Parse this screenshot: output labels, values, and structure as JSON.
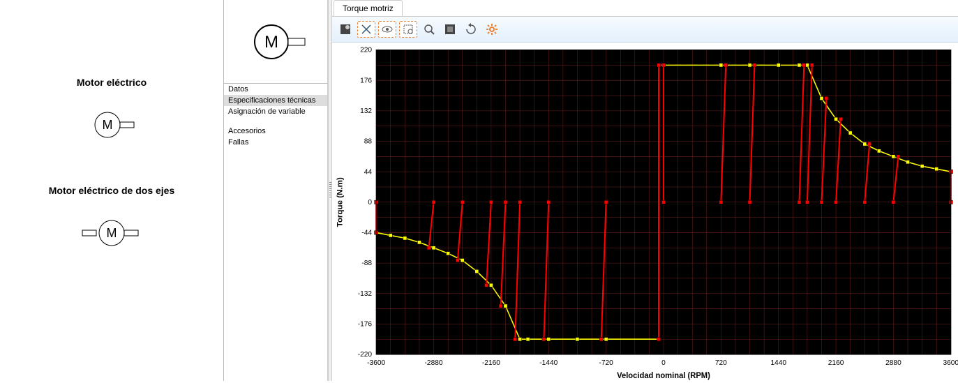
{
  "left": {
    "motor1_label": "Motor eléctrico",
    "motor2_label": "Motor eléctrico de dos ejes"
  },
  "nav": {
    "items": [
      {
        "label": "Datos",
        "selected": false
      },
      {
        "label": "Especificaciones técnicas",
        "selected": true
      },
      {
        "label": "Asignación de variable",
        "selected": false
      }
    ],
    "items2": [
      {
        "label": "Accesorios"
      },
      {
        "label": "Fallas"
      }
    ]
  },
  "tab": {
    "label": "Torque motriz"
  },
  "toolbar": {
    "btns": [
      {
        "name": "tool-crop",
        "glyph": "✂"
      },
      {
        "name": "tool-autoscale",
        "glyph": "⤢"
      },
      {
        "name": "tool-visibility",
        "glyph": "◉"
      },
      {
        "name": "tool-zoom-region",
        "glyph": "⬚"
      },
      {
        "name": "tool-zoom",
        "glyph": "🔍"
      },
      {
        "name": "tool-snapshot",
        "glyph": "◩"
      },
      {
        "name": "tool-refresh",
        "glyph": "⟳"
      },
      {
        "name": "tool-settings",
        "glyph": "⚙"
      }
    ]
  },
  "chart_data": {
    "type": "line",
    "title": "",
    "xlabel": "Velocidad nominal (RPM)",
    "ylabel": "Torque (N.m)",
    "xlim": [
      -3600,
      3600
    ],
    "ylim": [
      -220,
      220
    ],
    "xticks": [
      -3600,
      -2880,
      -2160,
      -1440,
      -720,
      0,
      720,
      1440,
      2160,
      2880,
      3600
    ],
    "yticks": [
      -220,
      -176,
      -132,
      -88,
      -44,
      0,
      44,
      88,
      132,
      176,
      220
    ],
    "series": [
      {
        "name": "envelope",
        "color": "#ffff00",
        "points": [
          [
            -3600,
            -44
          ],
          [
            -3420,
            -48
          ],
          [
            -3240,
            -52
          ],
          [
            -3060,
            -58
          ],
          [
            -2880,
            -66
          ],
          [
            -2700,
            -74
          ],
          [
            -2520,
            -84
          ],
          [
            -2340,
            -100
          ],
          [
            -2160,
            -120
          ],
          [
            -1980,
            -150
          ],
          [
            -1800,
            -198
          ],
          [
            -1700,
            -198
          ],
          [
            -1440,
            -198
          ],
          [
            -1080,
            -198
          ],
          [
            -720,
            -198
          ],
          [
            -60,
            -198
          ],
          [
            -60,
            198
          ],
          [
            0,
            198
          ],
          [
            720,
            198
          ],
          [
            1080,
            198
          ],
          [
            1440,
            198
          ],
          [
            1700,
            198
          ],
          [
            1800,
            198
          ],
          [
            1980,
            150
          ],
          [
            2160,
            120
          ],
          [
            2340,
            100
          ],
          [
            2520,
            84
          ],
          [
            2700,
            74
          ],
          [
            2880,
            66
          ],
          [
            3060,
            58
          ],
          [
            3240,
            52
          ],
          [
            3420,
            48
          ],
          [
            3600,
            44
          ]
        ]
      },
      {
        "name": "ticks-neg",
        "color": "#ff0000",
        "segments": [
          [
            [
              -3600,
              0
            ],
            [
              -3600,
              -44
            ]
          ],
          [
            [
              -2880,
              0
            ],
            [
              -2940,
              -66
            ]
          ],
          [
            [
              -2520,
              0
            ],
            [
              -2580,
              -84
            ]
          ],
          [
            [
              -2160,
              0
            ],
            [
              -2220,
              -120
            ]
          ],
          [
            [
              -1980,
              0
            ],
            [
              -2040,
              -150
            ]
          ],
          [
            [
              -1800,
              0
            ],
            [
              -1860,
              -198
            ]
          ],
          [
            [
              -1440,
              0
            ],
            [
              -1500,
              -198
            ]
          ],
          [
            [
              -720,
              0
            ],
            [
              -780,
              -198
            ]
          ],
          [
            [
              -60,
              -198
            ],
            [
              -60,
              198
            ]
          ]
        ]
      },
      {
        "name": "ticks-pos",
        "color": "#ff0000",
        "segments": [
          [
            [
              0,
              0
            ],
            [
              0,
              198
            ]
          ],
          [
            [
              720,
              0
            ],
            [
              780,
              198
            ]
          ],
          [
            [
              1080,
              0
            ],
            [
              1140,
              198
            ]
          ],
          [
            [
              1700,
              0
            ],
            [
              1760,
              198
            ]
          ],
          [
            [
              1800,
              0
            ],
            [
              1860,
              198
            ]
          ],
          [
            [
              1980,
              0
            ],
            [
              2040,
              150
            ]
          ],
          [
            [
              2160,
              0
            ],
            [
              2220,
              120
            ]
          ],
          [
            [
              2520,
              0
            ],
            [
              2580,
              84
            ]
          ],
          [
            [
              2880,
              0
            ],
            [
              2940,
              66
            ]
          ],
          [
            [
              3600,
              0
            ],
            [
              3600,
              44
            ]
          ]
        ]
      }
    ]
  }
}
